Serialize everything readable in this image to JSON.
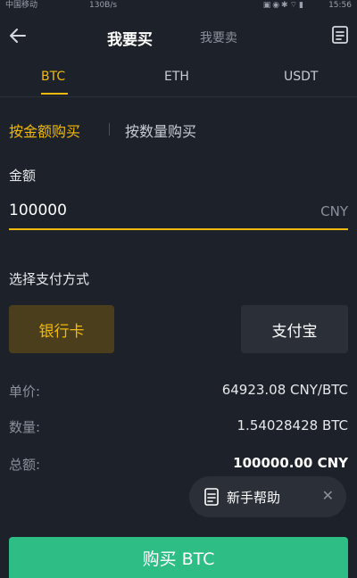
{
  "status_bar": {
    "carrier": "中国移动",
    "speed": "130B/s",
    "time": "15:56"
  },
  "header": {
    "active_tab": "我要买",
    "inactive_tab": "我要卖"
  },
  "coin_tabs": [
    "BTC",
    "ETH",
    "USDT"
  ],
  "mode_tabs": {
    "active": "按金额购买",
    "inactive": "按数量购买"
  },
  "amount": {
    "label": "金额",
    "value": "100000",
    "unit": "CNY"
  },
  "payment": {
    "label": "选择支付方式",
    "options": [
      "银行卡",
      "支付宝"
    ],
    "selected": "银行卡"
  },
  "details": [
    {
      "label": "单价:",
      "value": "64923.08 CNY/BTC"
    },
    {
      "label": "数量:",
      "value": "1.54028428 BTC"
    },
    {
      "label": "总额:",
      "value": "100000.00 CNY"
    }
  ],
  "help": {
    "label": "新手帮助"
  },
  "buy_button": {
    "label": "购买 BTC"
  },
  "colors": {
    "background": "#1d2129",
    "accent": "#f0b90b",
    "buy": "#2ebd85"
  }
}
